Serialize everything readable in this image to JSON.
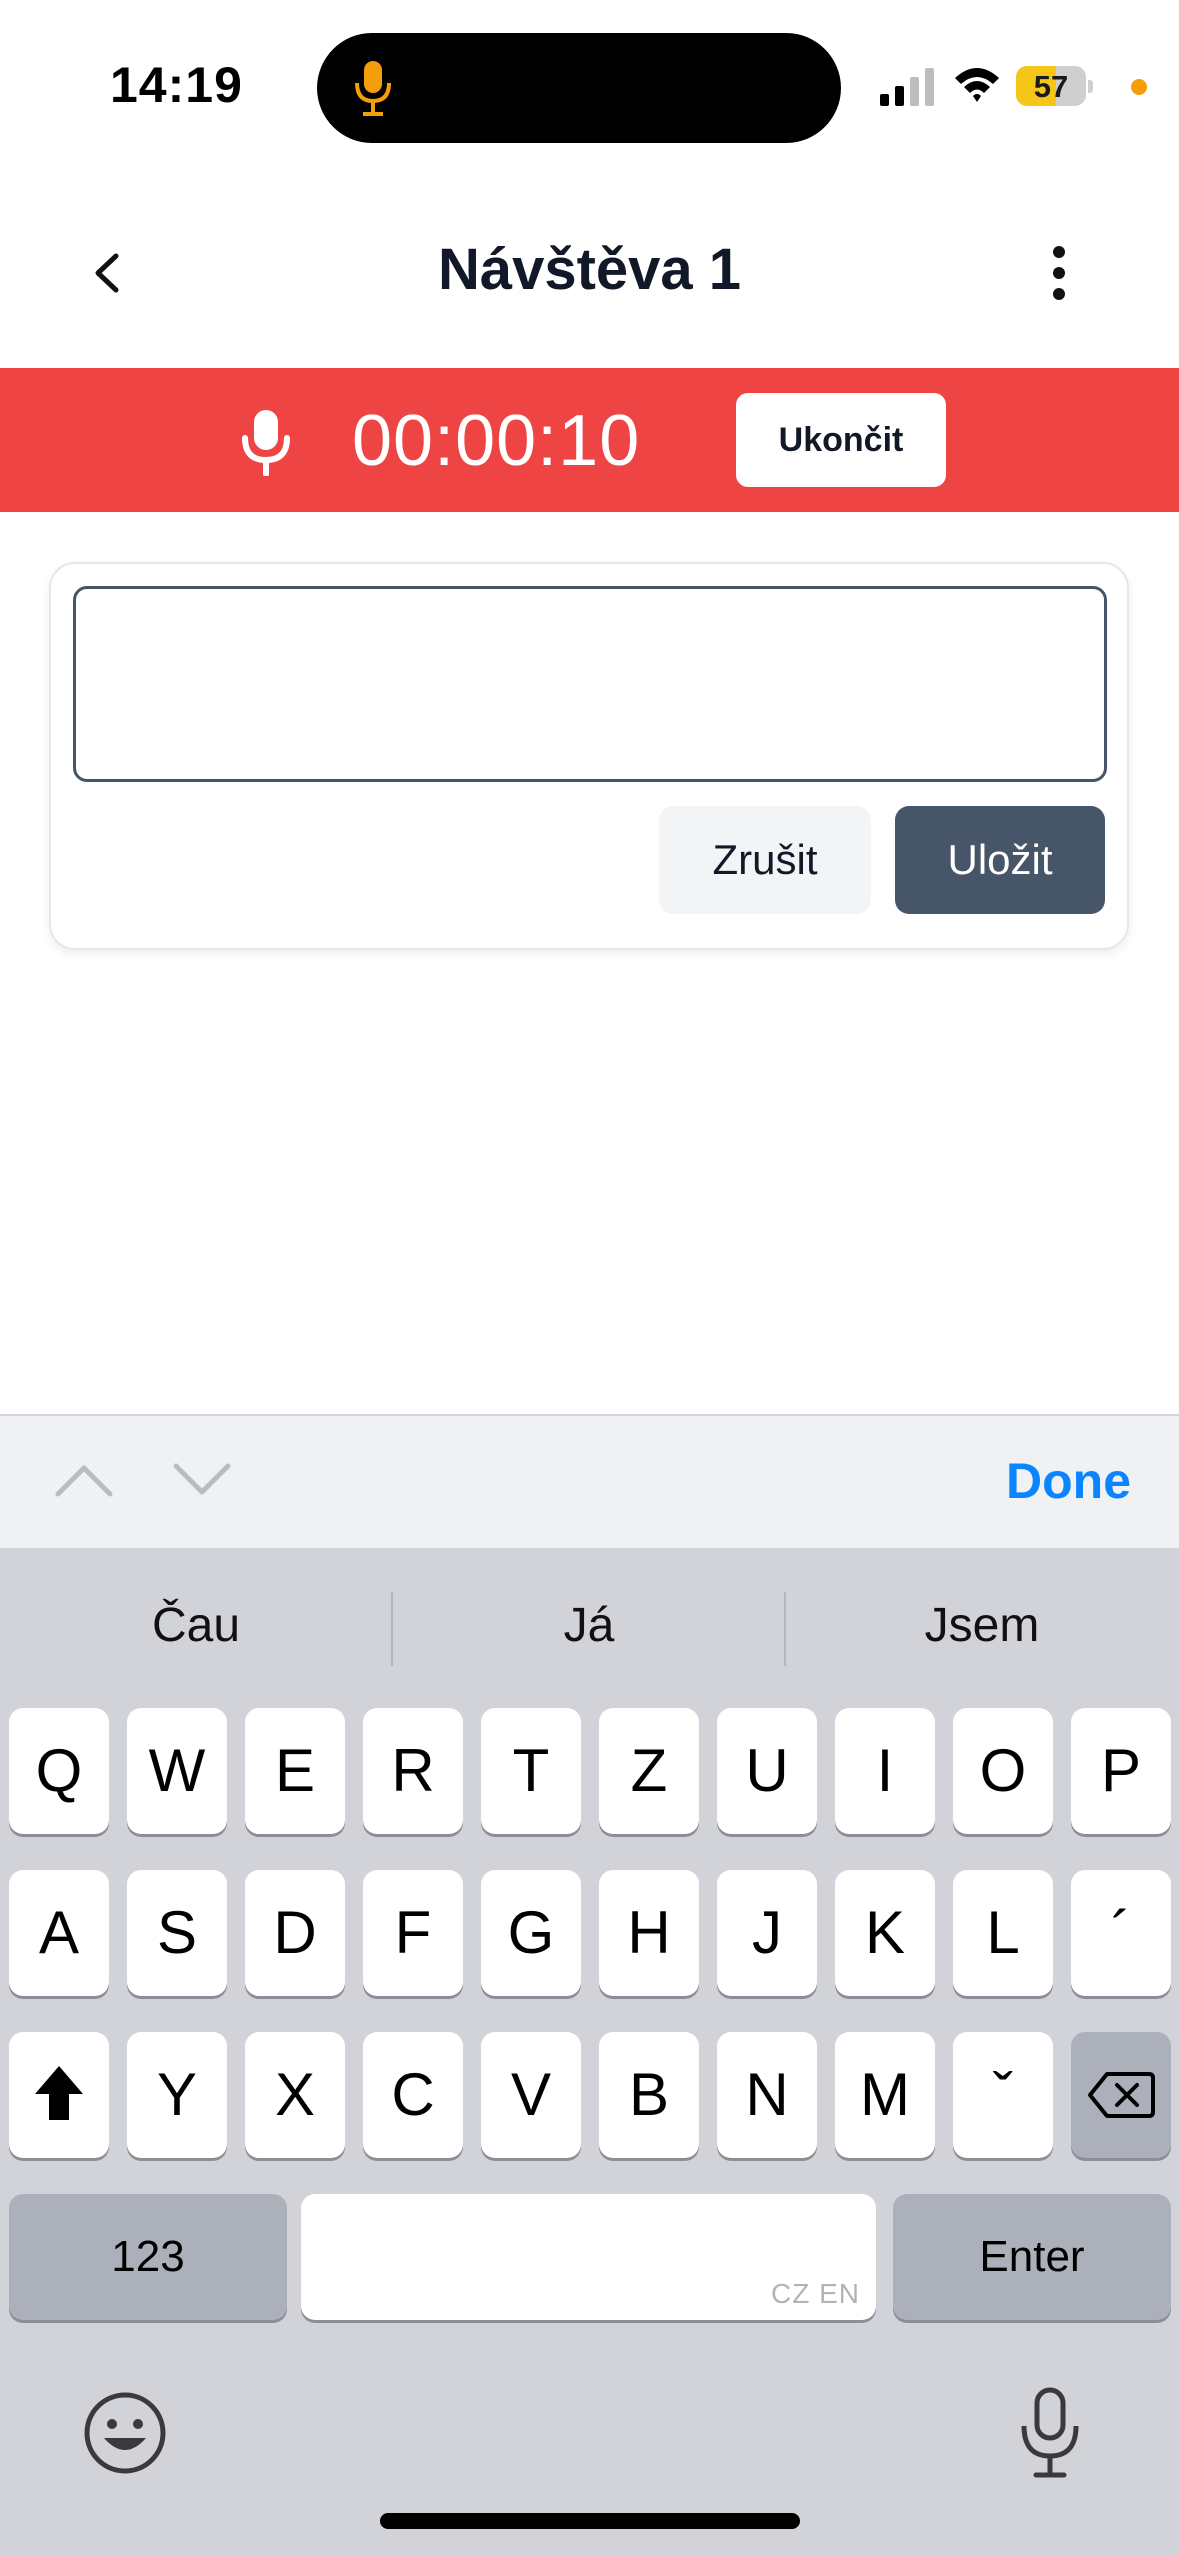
{
  "status_bar": {
    "time": "14:19",
    "battery_level": "57",
    "battery_fraction": 0.57,
    "mic_indicator_color": "#f59e0b"
  },
  "header": {
    "title": "Návštěva 1",
    "back_icon": "chevron-left-icon",
    "more_icon": "more-vertical-icon"
  },
  "recording": {
    "timer": "00:00:10",
    "stop_label": "Ukončit",
    "color": "#ef4444"
  },
  "note_form": {
    "input_value": "",
    "cancel_label": "Zrušit",
    "save_label": "Uložit"
  },
  "keyboard_toolbar": {
    "done_label": "Done"
  },
  "keyboard": {
    "suggestions": [
      "Čau",
      "Já",
      "Jsem"
    ],
    "row1": [
      "Q",
      "W",
      "E",
      "R",
      "T",
      "Z",
      "U",
      "I",
      "O",
      "P"
    ],
    "row2": [
      "A",
      "S",
      "D",
      "F",
      "G",
      "H",
      "J",
      "K",
      "L",
      "´"
    ],
    "row3": [
      "Y",
      "X",
      "C",
      "V",
      "B",
      "N",
      "M",
      "ˇ"
    ],
    "numbers_label": "123",
    "enter_label": "Enter",
    "space_languages": "CZ EN"
  }
}
